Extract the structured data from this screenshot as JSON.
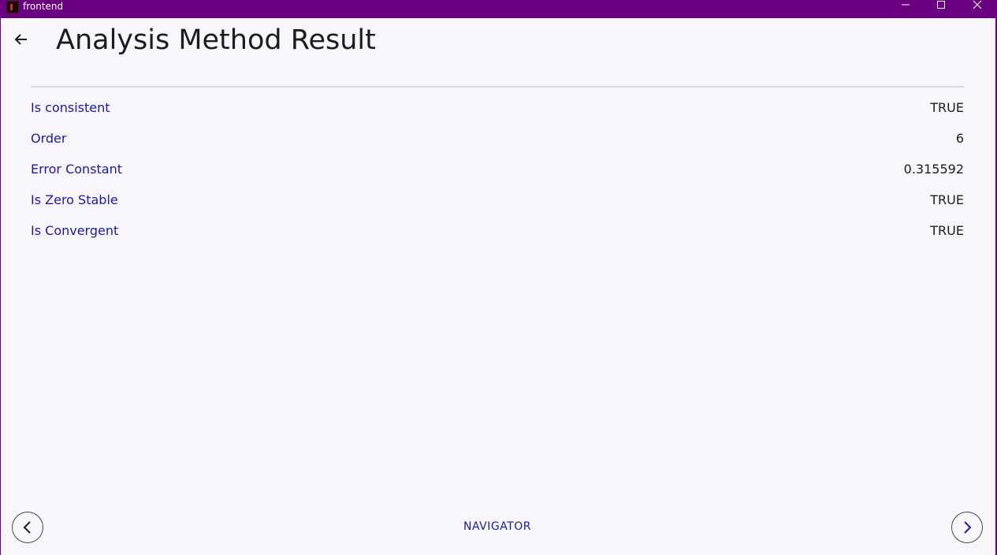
{
  "window": {
    "title": "frontend",
    "controls": {
      "minimize_icon": "minimize-icon",
      "maximize_icon": "maximize-icon",
      "close_icon": "close-icon"
    }
  },
  "header": {
    "back_icon": "arrow-left-icon",
    "title": "Analysis Method Result"
  },
  "results": [
    {
      "label": "Is consistent",
      "value": "TRUE"
    },
    {
      "label": "Order",
      "value": "6"
    },
    {
      "label": "Error Constant",
      "value": "0.315592"
    },
    {
      "label": "Is Zero Stable",
      "value": "TRUE"
    },
    {
      "label": "Is Convergent",
      "value": "TRUE"
    }
  ],
  "footer": {
    "navigator_label": "NAVIGATOR",
    "prev_icon": "chevron-left-icon",
    "next_icon": "chevron-right-icon"
  },
  "colors": {
    "titlebar": "#6a0080",
    "background": "#f8f6fb",
    "label_text": "#1a1aa0",
    "value_text": "#1c1b1f",
    "next_chevron": "#1a1aa0",
    "prev_chevron": "#1c1b1f"
  }
}
